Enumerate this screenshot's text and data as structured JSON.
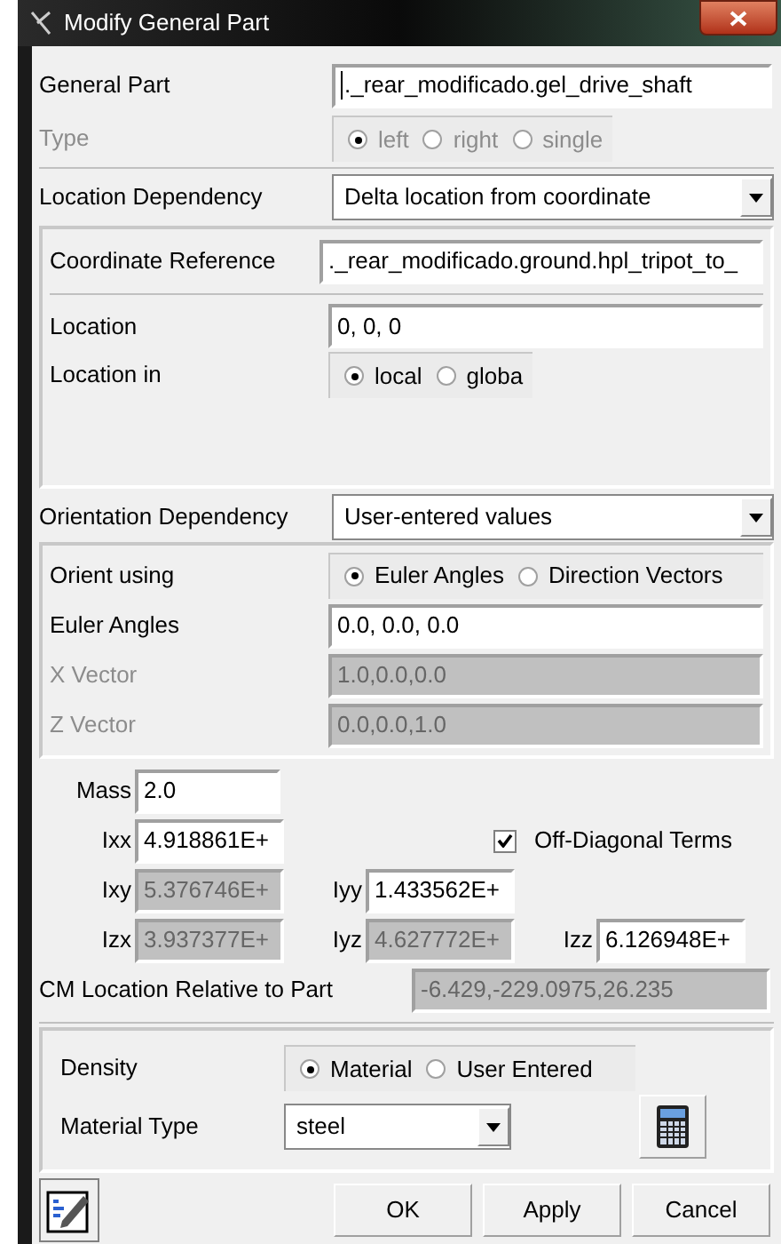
{
  "window": {
    "title": "Modify General Part"
  },
  "general_part": {
    "label": "General Part",
    "value": "._rear_modificado.gel_drive_shaft",
    "focused": true
  },
  "type": {
    "label": "Type",
    "disabled": true,
    "options": [
      {
        "label": "left",
        "selected": true
      },
      {
        "label": "right",
        "selected": false
      },
      {
        "label": "single",
        "selected": false
      }
    ]
  },
  "location_dependency": {
    "label": "Location Dependency",
    "value": "Delta location from coordinate"
  },
  "coordinate_reference": {
    "label": "Coordinate Reference",
    "value": "._rear_modificado.ground.hpl_tripot_to_"
  },
  "location": {
    "label": "Location",
    "value": "0, 0, 0"
  },
  "location_in": {
    "label": "Location in",
    "options": [
      {
        "label": "local",
        "selected": true
      },
      {
        "label": "globa",
        "selected": false
      }
    ]
  },
  "orientation_dependency": {
    "label": "Orientation Dependency",
    "value": "User-entered values"
  },
  "orient_using": {
    "label": "Orient using",
    "options": [
      {
        "label": "Euler Angles",
        "selected": true
      },
      {
        "label": "Direction Vectors",
        "selected": false
      }
    ]
  },
  "orientation_fields": [
    {
      "label": "Euler Angles",
      "value": "0.0, 0.0, 0.0",
      "disabled": false
    },
    {
      "label": "X Vector",
      "value": "1.0,0.0,0.0",
      "disabled": true
    },
    {
      "label": "Z Vector",
      "value": "0.0,0.0,1.0",
      "disabled": true
    }
  ],
  "mass": {
    "label": "Mass",
    "value": "2.0"
  },
  "inertia_rows": [
    {
      "cells": [
        {
          "label": "Ixx",
          "value": "4.918861E+",
          "disabled": false
        }
      ]
    },
    {
      "cells": [
        {
          "label": "Ixy",
          "value": "5.376746E+",
          "disabled": true
        },
        {
          "label": "Iyy",
          "value": "1.433562E+",
          "disabled": false
        }
      ]
    },
    {
      "cells": [
        {
          "label": "Izx",
          "value": "3.937377E+",
          "disabled": true
        },
        {
          "label": "Iyz",
          "value": "4.627772E+",
          "disabled": true
        },
        {
          "label": "Izz",
          "value": "6.126948E+",
          "disabled": false
        }
      ]
    }
  ],
  "off_diagonal": {
    "label": "Off-Diagonal Terms",
    "checked": true
  },
  "cm_location": {
    "label": "CM Location Relative to Part",
    "value": "-6.429,-229.0975,26.235"
  },
  "density": {
    "label": "Density",
    "options": [
      {
        "label": "Material",
        "selected": true
      },
      {
        "label": "User Entered",
        "selected": false
      }
    ]
  },
  "material_type": {
    "label": "Material Type",
    "value": "steel"
  },
  "buttons": [
    "OK",
    "Apply",
    "Cancel"
  ]
}
